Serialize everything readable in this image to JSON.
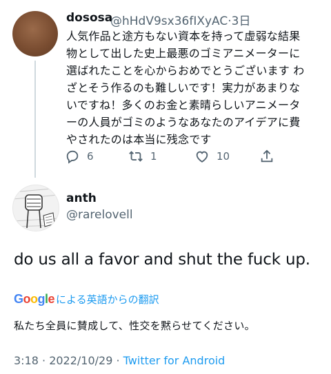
{
  "reply": {
    "display_name": "dososa",
    "handle": "@hHdV9sx36fIXyAC",
    "separator": "·",
    "age": "3日",
    "text": "人気作品と途方もない資本を持って虚弱な結果\n物として出した史上最悪のゴミアニメーターに\n選ばれたことを心からおめでとうございます わ\nざとそう作るのも難しいです！実力があまりな\nいですね！多くのお金と素晴らしいアニメータ\nーの人員がゴミのようなあなたのアイデアに費\nやされたのは本当に残念です",
    "actions": {
      "reply_icon": "reply-icon",
      "reply_count": "6",
      "retweet_icon": "retweet-icon",
      "retweet_count": "1",
      "like_icon": "heart-icon",
      "like_count": "10",
      "share_icon": "share-icon"
    }
  },
  "tweet": {
    "display_name": "anth",
    "handle": "@rarelovell",
    "text": "do us all a favor and shut the fuck up.",
    "translate": {
      "google_logo_text": "Google",
      "label": "による英語からの翻訳"
    },
    "translated_text": "私たち全員に賛成して、性交を黙らせてください。",
    "timestamp": "3:18 · 2022/10/29 · ",
    "client": "Twitter for Android"
  },
  "colors": {
    "accent": "#1d9bf0",
    "secondary_text": "#536471",
    "primary_text": "#0f1419"
  }
}
